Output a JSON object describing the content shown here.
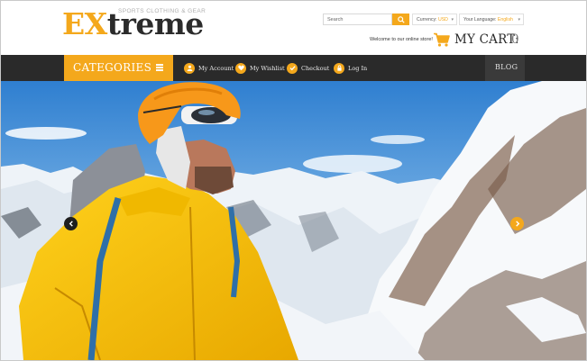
{
  "brand": {
    "logo_accent": "EX",
    "logo_rest": "treme",
    "tagline": "SPORTS CLOTHING & GEAR",
    "accent_color": "#f4a81c",
    "dark_color": "#2a2a2a"
  },
  "header": {
    "search_placeholder": "Search",
    "currency_label": "Currency:",
    "currency_value": "USD",
    "language_label": "Your Language:",
    "language_value": "English",
    "welcome_text": "Welcome to our online store!",
    "cart_label": "MY CART:",
    "cart_count": "0"
  },
  "nav": {
    "categories_label": "CATEGORIES",
    "links": [
      {
        "label": "My Account",
        "icon": "user-icon"
      },
      {
        "label": "My Wishlist",
        "icon": "heart-icon"
      },
      {
        "label": "Checkout",
        "icon": "check-icon"
      },
      {
        "label": "Log In",
        "icon": "lock-icon"
      }
    ],
    "blog_label": "BLOG"
  },
  "hero": {
    "image": "mountaineer-in-yellow-jacket-on-snowy-peaks",
    "prev_icon": "chevron-left-icon",
    "next_icon": "chevron-right-icon"
  }
}
